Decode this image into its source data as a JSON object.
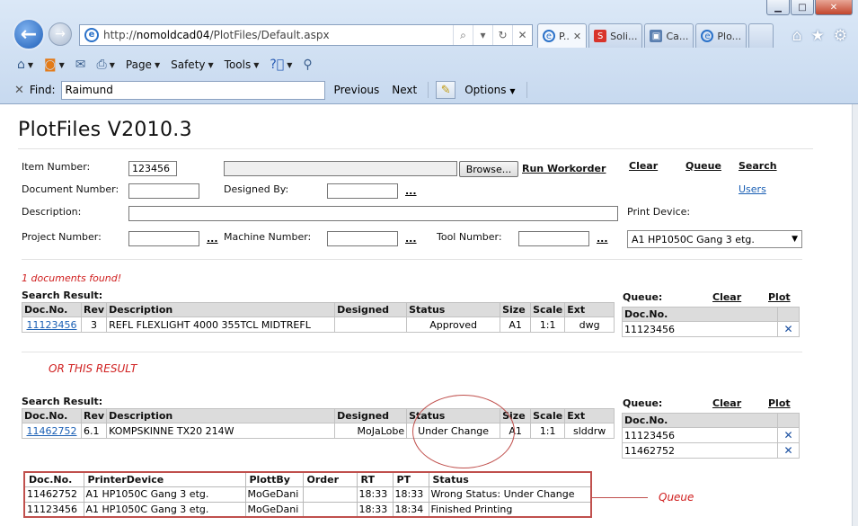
{
  "browser": {
    "address_url_prefix": "http://",
    "address_url_host": "nomoldcad04",
    "address_url_path": "/PlotFiles/Default.aspx",
    "tabs": [
      {
        "label": "P..",
        "active": true,
        "icon": "ie-icon"
      },
      {
        "label": "Soli...",
        "active": false,
        "icon": "solid-icon"
      },
      {
        "label": "Ca...",
        "active": false,
        "icon": "doc-icon"
      },
      {
        "label": "Plo...",
        "active": false,
        "icon": "ie-icon"
      }
    ],
    "commands": {
      "page": "Page",
      "safety": "Safety",
      "tools": "Tools"
    },
    "find": {
      "label": "Find:",
      "value": "Raimund",
      "previous": "Previous",
      "next": "Next",
      "options": "Options"
    }
  },
  "page": {
    "title": "PlotFiles V2010.3"
  },
  "form": {
    "item_number_label": "Item Number:",
    "item_number_value": "123456",
    "browse_label": "Browse...",
    "run_workorder_label": "Run Workorder",
    "document_number_label": "Document Number:",
    "designed_by_label": "Designed By:",
    "description_label": "Description:",
    "project_number_label": "Project Number:",
    "machine_number_label": "Machine Number:",
    "tool_number_label": "Tool Number:",
    "print_device_label": "Print Device:",
    "print_device_value": "A1 HP1050C Gang 3 etg.",
    "dots": "...",
    "links": {
      "clear": "Clear",
      "queue": "Queue",
      "search": "Search",
      "users": "Users"
    }
  },
  "results": {
    "found_text": "1 documents found!",
    "title": "Search Result:",
    "or_this_result": "OR THIS RESULT",
    "columns": [
      "Doc.No.",
      "Rev",
      "Description",
      "Designed",
      "Status",
      "Size",
      "Scale",
      "Ext"
    ],
    "result1": {
      "doc_no": "11123456",
      "rev": "3",
      "description": "REFL FLEXLIGHT 4000 355TCL MIDTREFL",
      "designed": "",
      "status": "Approved",
      "size": "A1",
      "scale": "1:1",
      "ext": "dwg"
    },
    "result2": {
      "doc_no": "11462752",
      "rev": "6.1",
      "description": "KOMPSKINNE TX20 214W",
      "designed": "MoJaLobe",
      "status": "Under Change",
      "size": "A1",
      "scale": "1:1",
      "ext": "slddrw"
    }
  },
  "queue_panel": {
    "title": "Queue:",
    "clear": "Clear",
    "plot": "Plot",
    "column": "Doc.No.",
    "remove_glyph": "✕",
    "list1": [
      "11123456"
    ],
    "list2": [
      "11123456",
      "11462752"
    ]
  },
  "queue_table": {
    "annotation": "Queue",
    "columns": [
      "Doc.No.",
      "PrinterDevice",
      "PlottBy",
      "Order",
      "RT",
      "PT",
      "Status"
    ],
    "rows": [
      {
        "doc_no": "11462752",
        "printer": "A1 HP1050C Gang 3 etg.",
        "by": "MoGeDani",
        "order": "",
        "rt": "18:33",
        "pt": "18:33",
        "status": "Wrong Status: Under Change"
      },
      {
        "doc_no": "11123456",
        "printer": "A1 HP1050C Gang 3 etg.",
        "by": "MoGeDani",
        "order": "",
        "rt": "18:33",
        "pt": "18:34",
        "status": "Finished Printing"
      }
    ]
  }
}
